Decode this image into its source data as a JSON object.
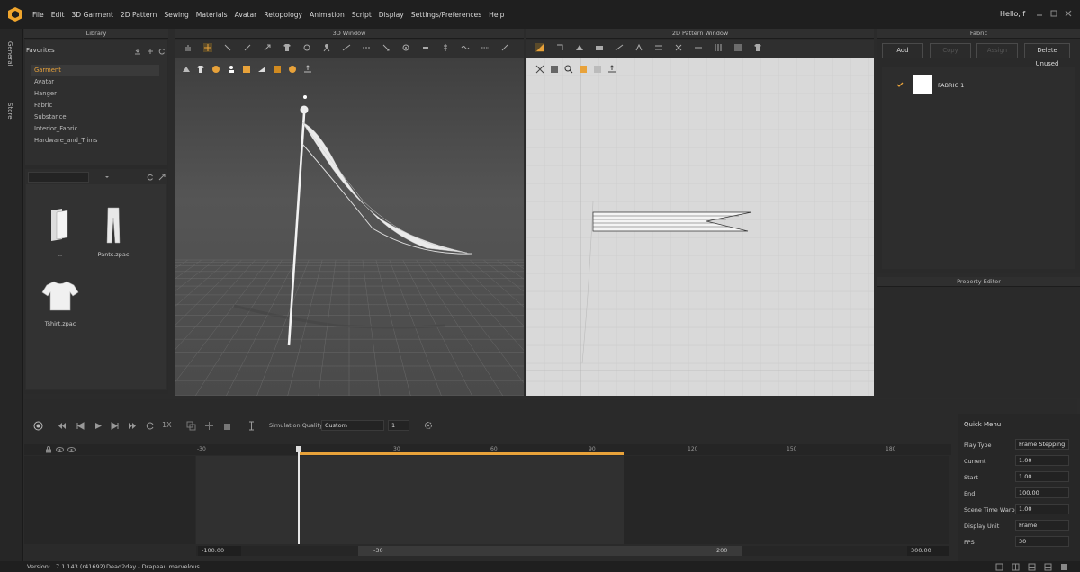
{
  "menu": [
    "File",
    "Edit",
    "3D Garment",
    "2D Pattern",
    "Sewing",
    "Materials",
    "Avatar",
    "Retopology",
    "Animation",
    "Script",
    "Display",
    "Settings/Preferences",
    "Help"
  ],
  "user": {
    "greeting": "Hello, f"
  },
  "sidebar_tabs": {
    "general": "General",
    "store": "Store"
  },
  "library": {
    "title": "Library",
    "favorites": "Favorites",
    "items": [
      "Garment",
      "Avatar",
      "Hanger",
      "Fabric",
      "Substance",
      "Interior_Fabric",
      "Hardware_and_Trims"
    ],
    "selected": "Garment",
    "files": [
      {
        "name": ".."
      },
      {
        "name": "Pants.zpac"
      },
      {
        "name": "Tshirt.zpac"
      }
    ]
  },
  "window3d": {
    "title": "3D Window"
  },
  "window2d": {
    "title": "2D Pattern Window"
  },
  "fabric_panel": {
    "title": "Fabric",
    "buttons": {
      "add": "Add",
      "copy": "Copy",
      "assign": "Assign",
      "delete_unused": "Delete Unused"
    },
    "fabrics": [
      {
        "name": "FABRIC 1",
        "checked": true
      }
    ]
  },
  "property_editor": {
    "title": "Property Editor"
  },
  "animation": {
    "speed": "1X",
    "sim_quality_label": "Simulation Quality",
    "sim_quality": "Custom",
    "sim_value": "1",
    "ticks": [
      "-30",
      "30",
      "60",
      "90",
      "120",
      "150",
      "180"
    ],
    "range_start": "-100.00",
    "range_mid_start": "-30",
    "range_mid_end": "200",
    "range_end": "300.00"
  },
  "quick_menu": {
    "title": "Quick Menu",
    "rows": [
      {
        "label": "Play Type",
        "value": "Frame Stepping"
      },
      {
        "label": "Current",
        "value": "1.00"
      },
      {
        "label": "Start",
        "value": "1.00"
      },
      {
        "label": "End",
        "value": "100.00"
      },
      {
        "label": "Scene Time Warp",
        "value": "1.00"
      },
      {
        "label": "Display Unit",
        "value": "Frame"
      },
      {
        "label": "FPS",
        "value": "30"
      }
    ]
  },
  "status": {
    "version_label": "Version:",
    "version": "7.1.143 (r41692)",
    "project": "Dead2day - Drapeau marvelous"
  },
  "colors": {
    "accent": "#e8a23a",
    "bg": "#2b2b2b",
    "pattern_bg": "#d9d9d9"
  }
}
